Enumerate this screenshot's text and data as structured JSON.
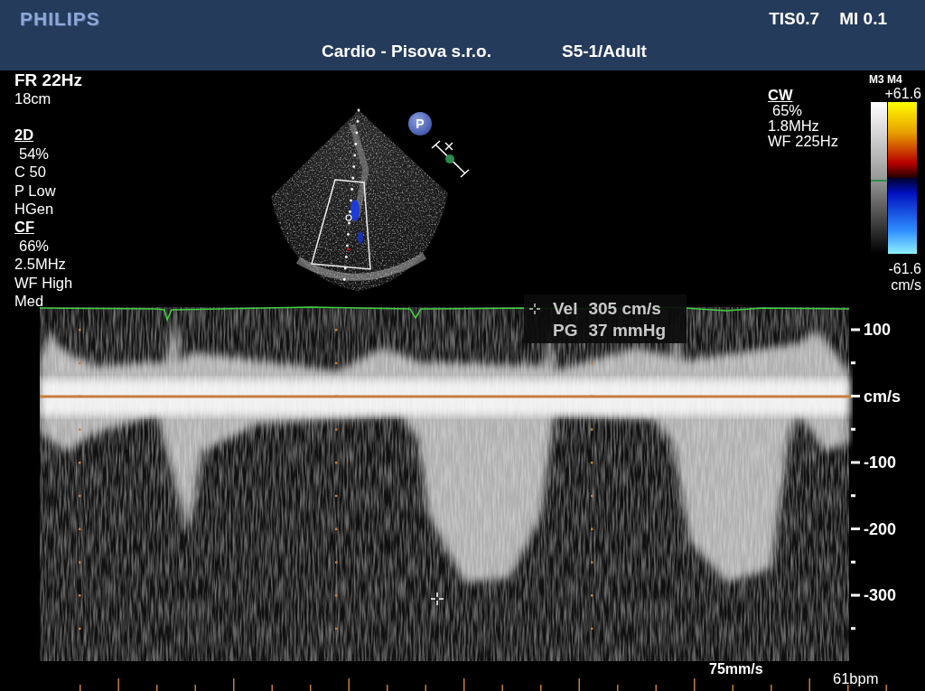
{
  "header": {
    "logo": "PHILIPS",
    "tis": "TIS0.7",
    "mi": "MI 0.1",
    "title": "Cardio - Pisova s.r.o.",
    "probe": "S5-1/Adult"
  },
  "imaging_params": {
    "frame_rate": "FR 22Hz",
    "depth": "18cm",
    "groups": [
      {
        "heading": "2D",
        "lines": [
          "54%",
          "C 50",
          "P Low",
          "HGen"
        ]
      },
      {
        "heading": "CF",
        "lines": [
          "66%",
          "2.5MHz",
          "WF High",
          "Med"
        ]
      }
    ]
  },
  "focus_badge": "P",
  "doppler_params": {
    "heading": "CW",
    "lines": [
      "65%",
      "1.8MHz",
      "WF 225Hz"
    ]
  },
  "color_bar": {
    "modes": "M3 M4",
    "max": "+61.6",
    "min": "-61.6",
    "unit": "cm/s"
  },
  "measurement": {
    "velocity_label": "Vel",
    "velocity": "305 cm/s",
    "gradient_label": "PG",
    "gradient": "37 mmHg"
  },
  "velocity_scale": {
    "ticks": [
      "100",
      "cm/s",
      "-100",
      "-200",
      "-300"
    ]
  },
  "sweep_speed": "75mm/s",
  "heart_rate": "61bpm"
}
